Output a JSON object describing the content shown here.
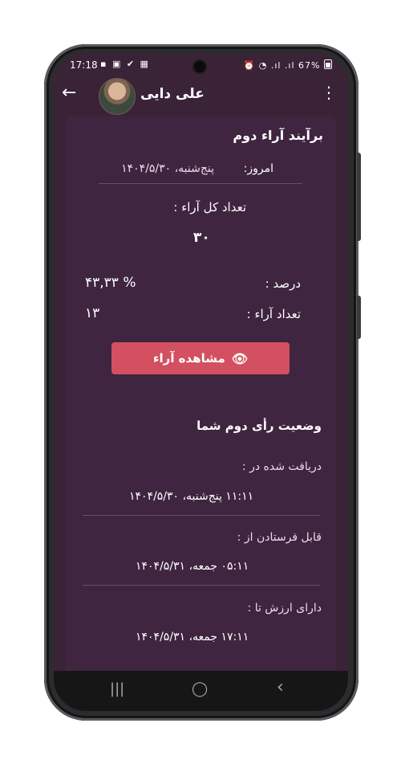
{
  "status_bar": {
    "time": "17:18",
    "left_icons": "▪ ▣ ✔ ▦",
    "right_icons": "⏰ ◔ .ıl .ıl",
    "battery": "67%"
  },
  "app_bar": {
    "title": "علی دایی",
    "back_icon": "←",
    "menu_icon": "⋮"
  },
  "second_poll": {
    "heading": "برآیند آراء دوم",
    "today_label": "امروز:",
    "today_value": "پنج‌شنبه، ۱۴۰۴/۵/۳۰",
    "total_votes_label": "تعداد کل آراء :",
    "total_votes_value": "۳۰",
    "percent_label": "درصد :",
    "percent_value": "۴۳,۳۳ %",
    "votes_count_label": "تعداد آراء :",
    "votes_count_value": "۱۳",
    "view_button": "مشاهده آراء",
    "eye_icon": "👁"
  },
  "your_vote": {
    "heading": "وضعیت رأی دوم شما",
    "received_label": "دریافت شده در :",
    "received_value": "۱۱:۱۱  پنج‌شنبه، ۱۴۰۴/۵/۳۰",
    "sendable_label": "قابل فرستادن از :",
    "sendable_value": "۰۵:۱۱  جمعه، ۱۴۰۴/۵/۳۱",
    "valid_label": "دارای ارزش تا :",
    "valid_value": "۱۷:۱۱  جمعه، ۱۴۰۴/۵/۳۱"
  },
  "nav_bar": {
    "recents_icon": "|||",
    "home_icon": "◯",
    "back_icon": "‹"
  }
}
